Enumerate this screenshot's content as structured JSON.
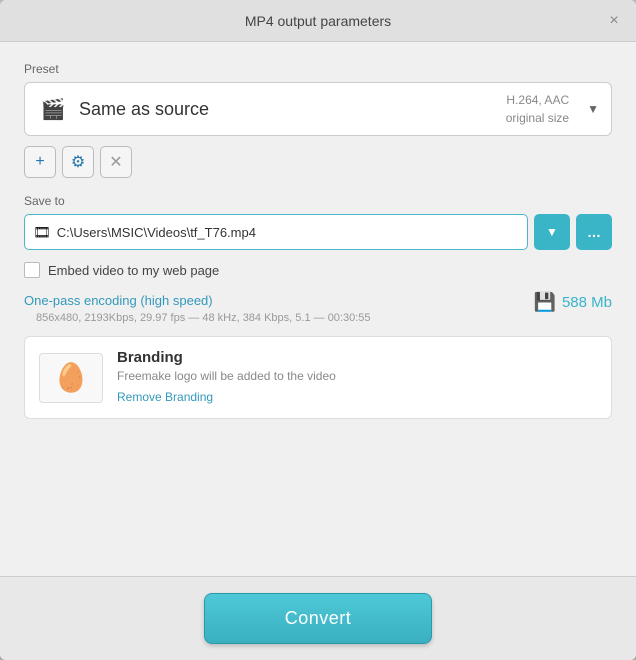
{
  "dialog": {
    "title": "MP4 output parameters",
    "close_label": "×"
  },
  "preset": {
    "section_label": "Preset",
    "icon": "🎬",
    "name": "Same as source",
    "codec": "H.264, AAC",
    "size": "original size",
    "arrow": "▼"
  },
  "preset_actions": {
    "add_label": "+",
    "settings_label": "⚙",
    "delete_label": "✕"
  },
  "save_to": {
    "section_label": "Save to",
    "path_icon": "🎞",
    "path_value": "C:\\Users\\MSIC\\Videos\\tf_T76.mp4",
    "dropdown_icon": "▼",
    "browse_icon": "…"
  },
  "embed": {
    "label": "Embed video to my web page"
  },
  "encoding": {
    "link_text": "One-pass encoding (high speed)",
    "details": "856x480, 2193Kbps, 29.97 fps — 48 kHz, 384 Kbps, 5.1 — 00:30:55",
    "size_icon": "💾",
    "size_value": "588 Mb"
  },
  "branding": {
    "icon": "🥚",
    "title": "Branding",
    "description": "Freemake logo will be added to the video",
    "remove_link": "Remove Branding"
  },
  "convert": {
    "label": "Convert"
  }
}
